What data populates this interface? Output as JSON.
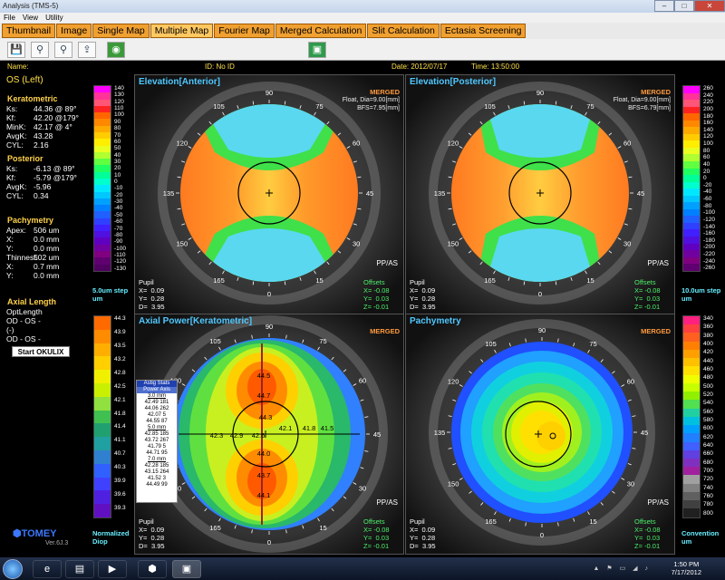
{
  "window": {
    "title": "Analysis (TMS-5)"
  },
  "menu": [
    "File",
    "View",
    "Utility"
  ],
  "tabs": [
    {
      "label": "Thumbnail",
      "active": false
    },
    {
      "label": "Image",
      "active": false
    },
    {
      "label": "Single Map",
      "active": false
    },
    {
      "label": "Multiple Map",
      "active": true
    },
    {
      "label": "Fourier Map",
      "active": false
    },
    {
      "label": "Merged Calculation",
      "active": false
    },
    {
      "label": "Slit Calculation",
      "active": false
    },
    {
      "label": "Ectasia Screening",
      "active": false
    }
  ],
  "toolbar_icons": [
    "save-icon",
    "scan-icon",
    "scan2-icon",
    "export-icon",
    "capture-icon",
    "green-camera-icon"
  ],
  "info": {
    "name": "Name:",
    "id": "ID: No ID",
    "date": "Date: 2012/07/17",
    "time": "Time: 13:50:00"
  },
  "patient": {
    "eye": "OS (Left)"
  },
  "keratometric": {
    "title": "Keratometric",
    "rows": [
      {
        "k": "Ks:",
        "v": "44.36 @ 89°"
      },
      {
        "k": "Kf:",
        "v": "42.20 @179°"
      },
      {
        "k": "MinK:",
        "v": "42.17 @  4°"
      },
      {
        "k": "AvgK:",
        "v": "43.28"
      },
      {
        "k": "CYL:",
        "v": "2.16"
      }
    ]
  },
  "posterior": {
    "title": "Posterior",
    "rows": [
      {
        "k": "Ks:",
        "v": "-6.13 @ 89°"
      },
      {
        "k": "Kf:",
        "v": "-5.79 @179°"
      },
      {
        "k": "AvgK:",
        "v": "-5.96"
      },
      {
        "k": "CYL:",
        "v": "0.34"
      }
    ]
  },
  "pachymetry_info": {
    "title": "Pachymetry",
    "rows": [
      {
        "k": "Apex:",
        "v": "506 um"
      },
      {
        "k": " X:",
        "v": "0.0 mm"
      },
      {
        "k": " Y:",
        "v": "0.0 mm"
      },
      {
        "k": "Thinnest:",
        "v": "502 um"
      },
      {
        "k": " X:",
        "v": "0.7 mm"
      },
      {
        "k": " Y:",
        "v": "0.0 mm"
      }
    ]
  },
  "axial_length": {
    "title": "Axial Length",
    "opt": "OptLength",
    "od1": "OD  -        OS  -",
    "paren": "(-)",
    "od2": "OD  -        OS  -",
    "button": "Start OKULIX"
  },
  "brand": {
    "logo": "TOMEY",
    "version": "Ver.6J.3"
  },
  "scale_elev_anterior": {
    "labels": [
      "140",
      "130",
      "120",
      "110",
      "100",
      "90",
      "80",
      "70",
      "60",
      "50",
      "40",
      "30",
      "20",
      "10",
      "0",
      "-10",
      "-20",
      "-30",
      "-40",
      "-50",
      "-60",
      "-70",
      "-80",
      "-90",
      "-100",
      "-110",
      "-120",
      "-130"
    ],
    "caption": "5.0um step\num"
  },
  "scale_elev_posterior": {
    "labels": [
      "260",
      "240",
      "220",
      "200",
      "180",
      "160",
      "140",
      "120",
      "100",
      "80",
      "60",
      "40",
      "20",
      "0",
      "-20",
      "-40",
      "-60",
      "-80",
      "-100",
      "-120",
      "-140",
      "-160",
      "-180",
      "-200",
      "-220",
      "-240",
      "-260"
    ],
    "caption": "10.0um step\num"
  },
  "scale_axial": {
    "labels": [
      "44.3",
      "43.9",
      "43.5",
      "43.2",
      "42.8",
      "42.5",
      "42.1",
      "41.8",
      "41.4",
      "41.1",
      "40.7",
      "40.3",
      "39.9",
      "39.6",
      "39.3"
    ],
    "caption": "Normalized\nDiop"
  },
  "scale_pachy": {
    "labels": [
      "340",
      "360",
      "380",
      "400",
      "420",
      "440",
      "460",
      "480",
      "500",
      "520",
      "540",
      "560",
      "580",
      "600",
      "620",
      "640",
      "660",
      "680",
      "700",
      "720",
      "740",
      "760",
      "780",
      "800"
    ],
    "caption": "Convention\num"
  },
  "maps": {
    "elev_anterior": {
      "title": "Elevation[Anterior]",
      "merged": "MERGED",
      "float": "Float, Dia=9.00[mm]\nBFS=7.95[mm]",
      "pupil": "Pupil\nX=  0.09\nY=  0.28\nD=  3.95",
      "offsets": "Offsets\nX= -0.08\nY=  0.03\nZ= -0.01",
      "ppas": "PP/AS"
    },
    "elev_posterior": {
      "title": "Elevation[Posterior]",
      "merged": "MERGED",
      "float": "Float, Dia=9.00[mm]\nBFS=6.79[mm]",
      "pupil": "Pupil\nX=  0.09\nY=  0.28\nD=  3.95",
      "offsets": "Offsets\nX= -0.08\nY=  0.03\nZ= -0.01",
      "ppas": "PP/AS"
    },
    "axial": {
      "title": "Axial Power[Keratometric]",
      "merged": "MERGED",
      "pupil": "Pupil\nX=  0.09\nY=  0.28\nD=  3.95",
      "offsets": "Offsets\nX= -0.08\nY=  0.03\nZ= -0.01",
      "ppas": "PP/AS",
      "values": [
        "44.5",
        "44.7",
        "44.3",
        "42.1",
        "41.8",
        "41.5",
        "42.3",
        "42.9",
        "42.6",
        "44.0",
        "43.7",
        "44.1"
      ]
    },
    "pachymetry": {
      "title": "Pachymetry",
      "merged": "MERGED",
      "pupil": "Pupil\nX=  0.09\nY=  0.28\nD=  3.95",
      "offsets": "Offsets\nX= -0.08\nY=  0.03\nZ= -0.01",
      "ppas": "PP/AS"
    }
  },
  "ring_labels": [
    "90",
    "75",
    "60",
    "45",
    "30",
    "15",
    "0",
    "165",
    "150",
    "135",
    "120",
    "105"
  ],
  "astig": {
    "title": "Astig Stats",
    "header": "Power  Axis",
    "groups": [
      {
        "mm": "3.0 mm",
        "rows": [
          "42.49  181",
          "44.06  262",
          "42.07    5",
          "44.55   87"
        ]
      },
      {
        "mm": "5.0 mm",
        "rows": [
          "42.85  185",
          "43.72  267",
          "41.79    5",
          "44.71   95"
        ]
      },
      {
        "mm": "7.0 mm",
        "rows": [
          "42.28  185",
          "43.15  264",
          "41.52    3",
          "44.49   99"
        ]
      }
    ]
  },
  "taskbar": {
    "time": "1:50 PM",
    "date": "7/17/2012"
  }
}
